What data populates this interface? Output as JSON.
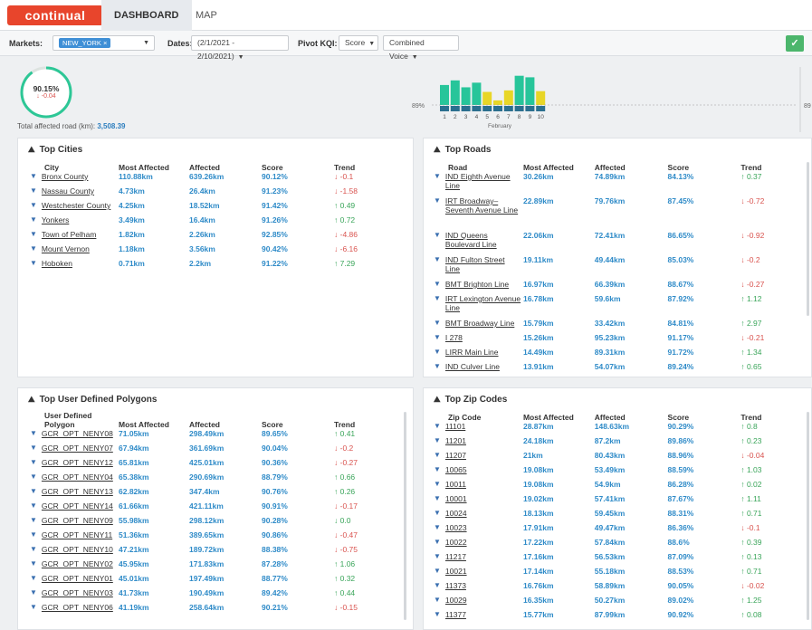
{
  "nav": {
    "logo": "continual",
    "tabs": [
      "DASHBOARD",
      "MAP"
    ]
  },
  "filters": {
    "markets_label": "Markets:",
    "market_chip": "NEW_YORK ×",
    "dates_label": "Dates:",
    "dates_value": "(2/1/2021 - 2/10/2021)",
    "pivot_label": "Pivot KQI:",
    "pivot_value": "Score",
    "voice_value": "Combined Voice"
  },
  "summary": {
    "score": "90.15%",
    "delta": "↓ -0.04",
    "total_label": "Total affected road (km):",
    "total_value": "3,508.39"
  },
  "chart_data": {
    "type": "bar",
    "categories": [
      "1",
      "2",
      "3",
      "4",
      "5",
      "6",
      "7",
      "8",
      "9",
      "10"
    ],
    "values": [
      91.6,
      92.2,
      91.3,
      91.9,
      90.7,
      89.6,
      90.9,
      92.8,
      92.6,
      90.8
    ],
    "xlabel": "February",
    "threshold_label": "89%",
    "right_label": "89",
    "colors": {
      "good": "#27c59a",
      "bad": "#e8d627"
    }
  },
  "top_cities": {
    "title": "Top Cities",
    "headers": [
      "City",
      "Most Affected",
      "Affected",
      "Score",
      "Trend"
    ],
    "rows": [
      {
        "name": "Bronx County",
        "most": "110.88km",
        "aff": "639.26km",
        "score": "90.12%",
        "trend": "↓ -0.1",
        "dir": "down"
      },
      {
        "name": "Nassau County",
        "most": "4.73km",
        "aff": "26.4km",
        "score": "91.23%",
        "trend": "↓ -1.58",
        "dir": "down"
      },
      {
        "name": "Westchester County",
        "most": "4.25km",
        "aff": "18.52km",
        "score": "91.42%",
        "trend": "↑ 0.49",
        "dir": "up"
      },
      {
        "name": "Yonkers",
        "most": "3.49km",
        "aff": "16.4km",
        "score": "91.26%",
        "trend": "↑ 0.72",
        "dir": "up"
      },
      {
        "name": "Town of Pelham",
        "most": "1.82km",
        "aff": "2.26km",
        "score": "92.85%",
        "trend": "↓ -4.86",
        "dir": "down"
      },
      {
        "name": "Mount Vernon",
        "most": "1.18km",
        "aff": "3.56km",
        "score": "90.42%",
        "trend": "↓ -6.16",
        "dir": "down"
      },
      {
        "name": "Hoboken",
        "most": "0.71km",
        "aff": "2.2km",
        "score": "91.22%",
        "trend": "↑ 7.29",
        "dir": "up"
      }
    ]
  },
  "top_roads": {
    "title": "Top Roads",
    "headers": [
      "Road",
      "Most Affected",
      "Affected",
      "Score",
      "Trend"
    ],
    "rows": [
      {
        "name": "IND Eighth Avenue Line",
        "most": "30.26km",
        "aff": "74.89km",
        "score": "84.13%",
        "trend": "↑ 0.37",
        "dir": "up",
        "h": 22
      },
      {
        "name": "IRT Broadway–Seventh Avenue Line",
        "most": "22.89km",
        "aff": "79.76km",
        "score": "87.45%",
        "trend": "↓ -0.72",
        "dir": "down",
        "h": 33
      },
      {
        "name": "IND Queens Boulevard Line",
        "most": "22.06km",
        "aff": "72.41km",
        "score": "86.65%",
        "trend": "↓ -0.92",
        "dir": "down",
        "h": 22
      },
      {
        "name": "IND Fulton Street Line",
        "most": "19.11km",
        "aff": "49.44km",
        "score": "85.03%",
        "trend": "↓ -0.2",
        "dir": "down",
        "h": 22
      },
      {
        "name": "BMT Brighton Line",
        "most": "16.97km",
        "aff": "66.39km",
        "score": "88.67%",
        "trend": "↓ -0.27",
        "dir": "down",
        "h": 11
      },
      {
        "name": "IRT Lexington Avenue Line",
        "most": "16.78km",
        "aff": "59.6km",
        "score": "87.92%",
        "trend": "↑ 1.12",
        "dir": "up",
        "h": 22
      },
      {
        "name": "BMT Broadway Line",
        "most": "15.79km",
        "aff": "33.42km",
        "score": "84.81%",
        "trend": "↑ 2.97",
        "dir": "up",
        "h": 11
      },
      {
        "name": "I 278",
        "most": "15.26km",
        "aff": "95.23km",
        "score": "91.17%",
        "trend": "↓ -0.21",
        "dir": "down",
        "h": 11
      },
      {
        "name": "LIRR Main Line",
        "most": "14.49km",
        "aff": "89.31km",
        "score": "91.72%",
        "trend": "↑ 1.34",
        "dir": "up",
        "h": 11
      },
      {
        "name": "IND Culver Line",
        "most": "13.91km",
        "aff": "54.07km",
        "score": "89.24%",
        "trend": "↑ 0.65",
        "dir": "up",
        "h": 11
      }
    ]
  },
  "top_polygons": {
    "title": "Top User Defined Polygons",
    "headers": [
      "User Defined Polygon",
      "Most Affected",
      "Affected",
      "Score",
      "Trend"
    ],
    "rows": [
      {
        "name": "GCR_OPT_NENY08",
        "most": "71.05km",
        "aff": "298.49km",
        "score": "89.65%",
        "trend": "↑ 0.41",
        "dir": "up"
      },
      {
        "name": "GCR_OPT_NENY07",
        "most": "67.94km",
        "aff": "361.69km",
        "score": "90.04%",
        "trend": "↓ -0.2",
        "dir": "down"
      },
      {
        "name": "GCR_OPT_NENY12",
        "most": "65.81km",
        "aff": "425.01km",
        "score": "90.36%",
        "trend": "↓ -0.27",
        "dir": "down"
      },
      {
        "name": "GCR_OPT_NENY04",
        "most": "65.38km",
        "aff": "290.69km",
        "score": "88.79%",
        "trend": "↑ 0.66",
        "dir": "up"
      },
      {
        "name": "GCR_OPT_NENY13",
        "most": "62.82km",
        "aff": "347.4km",
        "score": "90.76%",
        "trend": "↑ 0.26",
        "dir": "up"
      },
      {
        "name": "GCR_OPT_NENY14",
        "most": "61.66km",
        "aff": "421.11km",
        "score": "90.91%",
        "trend": "↓ -0.17",
        "dir": "down"
      },
      {
        "name": "GCR_OPT_NENY09",
        "most": "55.98km",
        "aff": "298.12km",
        "score": "90.28%",
        "trend": "↓ 0.0",
        "dir": "up"
      },
      {
        "name": "GCR_OPT_NENY11",
        "most": "51.36km",
        "aff": "389.65km",
        "score": "90.86%",
        "trend": "↓ -0.47",
        "dir": "down"
      },
      {
        "name": "GCR_OPT_NENY10",
        "most": "47.21km",
        "aff": "189.72km",
        "score": "88.38%",
        "trend": "↓ -0.75",
        "dir": "down"
      },
      {
        "name": "GCR_OPT_NENY02",
        "most": "45.95km",
        "aff": "171.83km",
        "score": "87.28%",
        "trend": "↑ 1.06",
        "dir": "up"
      },
      {
        "name": "GCR_OPT_NENY01",
        "most": "45.01km",
        "aff": "197.49km",
        "score": "88.77%",
        "trend": "↑ 0.32",
        "dir": "up"
      },
      {
        "name": "GCR_OPT_NENY03",
        "most": "41.73km",
        "aff": "190.49km",
        "score": "89.42%",
        "trend": "↑ 0.44",
        "dir": "up"
      },
      {
        "name": "GCR_OPT_NENY06",
        "most": "41.19km",
        "aff": "258.64km",
        "score": "90.21%",
        "trend": "↓ -0.15",
        "dir": "down"
      }
    ]
  },
  "top_zips": {
    "title": "Top Zip Codes",
    "headers": [
      "Zip Code",
      "Most Affected",
      "Affected",
      "Score",
      "Trend"
    ],
    "rows": [
      {
        "name": "11101",
        "most": "28.87km",
        "aff": "148.63km",
        "score": "90.29%",
        "trend": "↑ 0.8",
        "dir": "up"
      },
      {
        "name": "11201",
        "most": "24.18km",
        "aff": "87.2km",
        "score": "89.86%",
        "trend": "↑ 0.23",
        "dir": "up"
      },
      {
        "name": "11207",
        "most": "21km",
        "aff": "80.43km",
        "score": "88.96%",
        "trend": "↓ -0.04",
        "dir": "down"
      },
      {
        "name": "10065",
        "most": "19.08km",
        "aff": "53.49km",
        "score": "88.59%",
        "trend": "↑ 1.03",
        "dir": "up"
      },
      {
        "name": "10011",
        "most": "19.08km",
        "aff": "54.9km",
        "score": "86.28%",
        "trend": "↑ 0.02",
        "dir": "up"
      },
      {
        "name": "10001",
        "most": "19.02km",
        "aff": "57.41km",
        "score": "87.67%",
        "trend": "↑ 1.11",
        "dir": "up"
      },
      {
        "name": "10024",
        "most": "18.13km",
        "aff": "59.45km",
        "score": "88.31%",
        "trend": "↑ 0.71",
        "dir": "up"
      },
      {
        "name": "10023",
        "most": "17.91km",
        "aff": "49.47km",
        "score": "86.36%",
        "trend": "↓ -0.1",
        "dir": "down"
      },
      {
        "name": "10022",
        "most": "17.22km",
        "aff": "57.84km",
        "score": "88.6%",
        "trend": "↑ 0.39",
        "dir": "up"
      },
      {
        "name": "11217",
        "most": "17.16km",
        "aff": "56.53km",
        "score": "87.09%",
        "trend": "↑ 0.13",
        "dir": "up"
      },
      {
        "name": "10021",
        "most": "17.14km",
        "aff": "55.18km",
        "score": "88.53%",
        "trend": "↑ 0.71",
        "dir": "up"
      },
      {
        "name": "11373",
        "most": "16.76km",
        "aff": "58.89km",
        "score": "90.05%",
        "trend": "↓ -0.02",
        "dir": "down"
      },
      {
        "name": "10029",
        "most": "16.35km",
        "aff": "50.27km",
        "score": "89.02%",
        "trend": "↑ 1.25",
        "dir": "up"
      },
      {
        "name": "11377",
        "most": "15.77km",
        "aff": "87.99km",
        "score": "90.92%",
        "trend": "↑ 0.08",
        "dir": "up"
      }
    ]
  }
}
